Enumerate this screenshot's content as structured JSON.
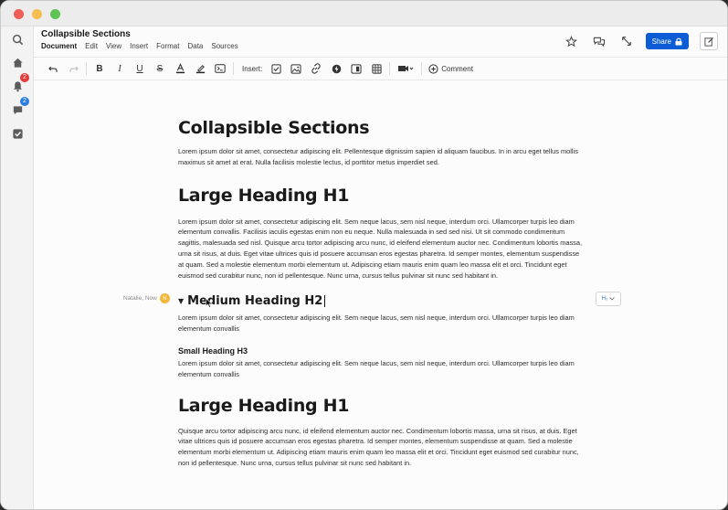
{
  "window": {
    "title": "Collapsible Sections"
  },
  "rail": {
    "notifications_badge": "2",
    "messages_badge": "2"
  },
  "menu": {
    "items": [
      "Document",
      "Edit",
      "View",
      "Insert",
      "Format",
      "Data",
      "Sources"
    ]
  },
  "header": {
    "share_label": "Share"
  },
  "toolbar": {
    "insert_label": "Insert:",
    "comment_label": "Comment"
  },
  "document": {
    "title": "Collapsible Sections",
    "intro": "Lorem ipsum dolor sit amet, consectetur adipiscing elit. Pellentesque dignissim sapien id aliquam faucibus. In in arcu eget tellus mollis maximus sit amet at erat. Nulla facilisis molestie lectus, id porttitor metus imperdiet sed.",
    "h1_a": "Large Heading H1",
    "p1": "Lorem ipsum dolor sit amet, consectetur adipiscing elit. Sem neque lacus, sem nisl neque, interdum orci. Ullamcorper turpis leo diam elementum convallis. Facilisis iaculis egestas enim non eu neque. Nulla malesuada in sed sed nisi. Ut sit commodo condimentum sagittis, malesuada sed nisl. Quisque arcu tortor adipiscing arcu nunc, id eleifend elementum auctor nec. Condimentum lobortis massa, urna sit risus, at duis. Eget vitae ultrices quis id posuere accumsan eros egestas pharetra. Id semper montes, elementum suspendisse at quam. Sed a molestie elementum morbi elementum ut. Adipiscing etiam mauris enim quam leo massa elit et orci. Tincidunt eget euismod sed curabitur nunc, non id pellentesque. Nunc urna, cursus tellus pulvinar sit nunc sed habitant in.",
    "h2": "Medium Heading H2",
    "p2": "Lorem ipsum dolor sit amet, consectetur adipiscing elit. Sem neque lacus, sem nisl neque, interdum orci. Ullamcorper turpis leo diam elementum convallis",
    "h3": "Small Heading H3",
    "p3": "Lorem ipsum dolor sit amet, consectetur adipiscing elit. Sem neque lacus, sem nisl neque, interdum orci. Ullamcorper turpis leo diam elementum convallis",
    "h1_b": "Large Heading H1",
    "p4": "Quisque arcu tortor adipiscing arcu nunc, id eleifend elementum auctor nec. Condimentum lobortis massa, urna sit risus, at duis. Eget vitae ultrices quis id posuere accumsan eros egestas pharetra. Id semper montes, elementum suspendisse at quam. Sed a molestie elementum morbi elementum ut. Adipiscing etiam mauris enim quam leo massa elit et orci. Tincidunt eget euismod sed curabitur nunc, non id pellentesque. Nunc urna, cursus tellus pulvinar sit nunc sed habitant in."
  },
  "presence": {
    "name": "Natalie, Now",
    "avatar_initial": "N"
  },
  "style_picker": {
    "value": "H₂"
  },
  "colors": {
    "accent": "#0b5cd5",
    "badge_red": "#e63a3a",
    "badge_blue": "#2b7de0",
    "presence": "#f3b63a"
  }
}
